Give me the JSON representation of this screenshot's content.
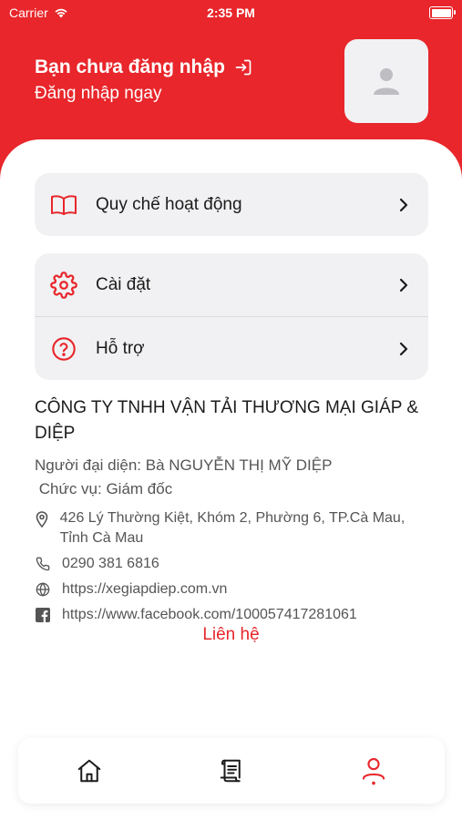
{
  "colors": {
    "primary": "#e8262b",
    "card": "#f1f1f3"
  },
  "status_bar": {
    "carrier": "Carrier",
    "time": "2:35 PM"
  },
  "header": {
    "title": "Bạn chưa đăng nhập",
    "subtitle": "Đăng nhập ngay"
  },
  "menu": {
    "rules": {
      "label": "Quy chế hoạt động",
      "icon": "book-icon"
    },
    "settings": {
      "label": "Cài đặt",
      "icon": "gear-icon"
    },
    "support": {
      "label": "Hỗ trợ",
      "icon": "help-circle-icon"
    }
  },
  "company": {
    "name": "CÔNG TY TNHH VẬN TẢI THƯƠNG MẠI GIÁP & DIỆP",
    "representative": "Người đại diện: Bà NGUYỄN THỊ MỸ DIỆP",
    "position": " Chức vụ: Giám đốc",
    "address": "426 Lý Thường Kiệt, Khóm 2, Phường 6, TP.Cà Mau, Tỉnh Cà Mau",
    "phone": "0290 381 6816",
    "website": "https://xegiapdiep.com.vn",
    "facebook": "https://www.facebook.com/100057417281061"
  },
  "contact_label": "Liên hệ",
  "tabs": [
    {
      "icon": "home-icon",
      "active": false
    },
    {
      "icon": "receipt-icon",
      "active": false
    },
    {
      "icon": "person-icon",
      "active": true
    }
  ]
}
